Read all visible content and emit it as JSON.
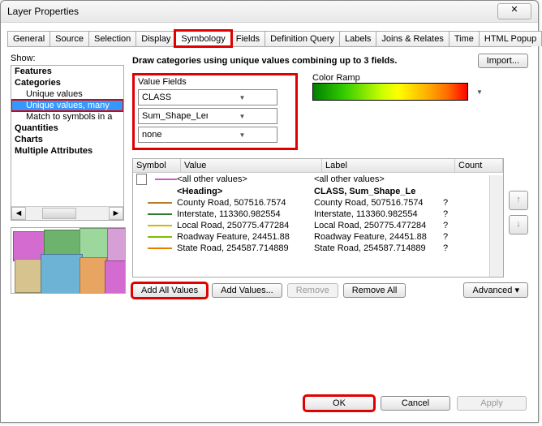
{
  "window_title": "Layer Properties",
  "close_glyph": "✕",
  "tabs": [
    "General",
    "Source",
    "Selection",
    "Display",
    "Symbology",
    "Fields",
    "Definition Query",
    "Labels",
    "Joins & Relates",
    "Time",
    "HTML Popup"
  ],
  "active_tab": "Symbology",
  "show_label": "Show:",
  "tree": {
    "features": "Features",
    "categories": "Categories",
    "unique_values": "Unique values",
    "unique_values_many": "Unique values, many",
    "match_symbols": "Match to symbols in a",
    "quantities": "Quantities",
    "charts": "Charts",
    "multiple": "Multiple Attributes"
  },
  "description": "Draw categories using unique values combining up to 3 fields.",
  "import_btn": "Import...",
  "value_fields_label": "Value Fields",
  "value_fields": [
    "CLASS",
    "Sum_Shape_Length",
    "none"
  ],
  "color_ramp_label": "Color Ramp",
  "grid": {
    "headers": {
      "symbol": "Symbol",
      "value": "Value",
      "label": "Label",
      "count": "Count"
    },
    "allother": {
      "value": "<all other values>",
      "label": "<all other values>",
      "count": ""
    },
    "heading": {
      "value": "<Heading>",
      "label": "CLASS, Sum_Shape_Le",
      "count": ""
    },
    "rows": [
      {
        "color": "#b37f29",
        "value": "County Road, 507516.7574",
        "label": "County Road, 507516.7574",
        "count": "?"
      },
      {
        "color": "#2b7a2b",
        "value": "Interstate, 113360.982554",
        "label": "Interstate, 113360.982554",
        "count": "?"
      },
      {
        "color": "#d6b600",
        "value": "Local Road, 250775.477284",
        "label": "Local Road, 250775.477284",
        "count": "?"
      },
      {
        "color": "#7fbf00",
        "value": "Roadway Feature, 24451.88",
        "label": "Roadway Feature, 24451.88",
        "count": "?"
      },
      {
        "color": "#e67e00",
        "value": "State Road, 254587.714889",
        "label": "State Road, 254587.714889",
        "count": "?"
      }
    ]
  },
  "buttons": {
    "add_all": "Add All Values",
    "add": "Add Values...",
    "remove": "Remove",
    "remove_all": "Remove All",
    "advanced": "Advanced  ▾",
    "ok": "OK",
    "cancel": "Cancel",
    "apply": "Apply"
  },
  "arrows": {
    "up": "↑",
    "down": "↓",
    "left": "◄",
    "right": "►",
    "drop": "▼"
  }
}
